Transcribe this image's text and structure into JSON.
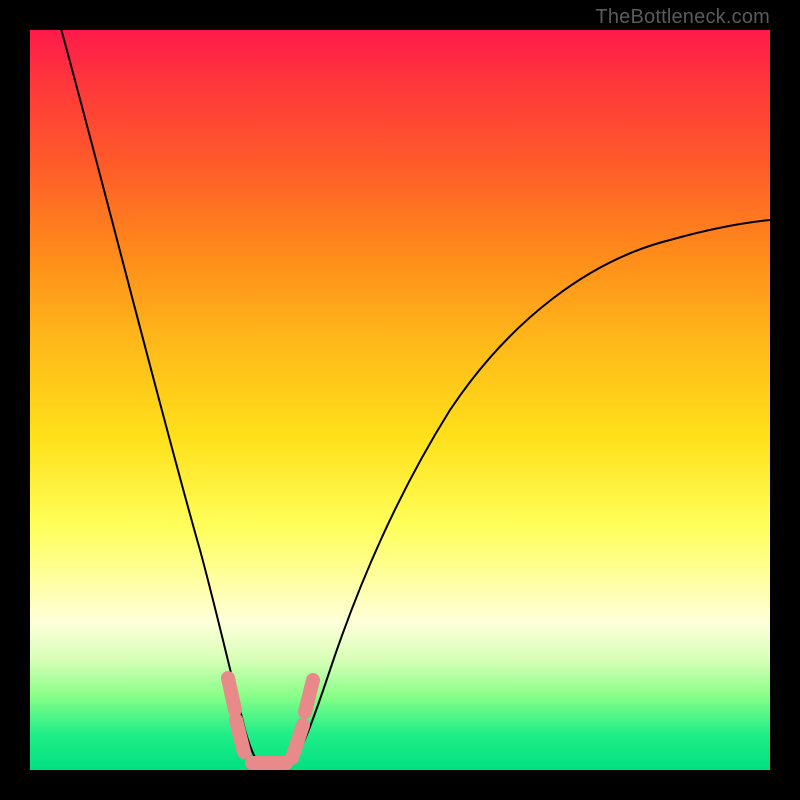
{
  "watermark": "TheBottleneck.com",
  "chart_data": {
    "type": "line",
    "title": "",
    "xlabel": "",
    "ylabel": "",
    "x_range": [
      0,
      100
    ],
    "y_range": [
      0,
      100
    ],
    "note": "V-shaped bottleneck curve on a red-to-green gradient background. The curve value indicates distance from optimal (0 at minimum). Values below are estimated from the plotted curve against the vertical gradient.",
    "series": [
      {
        "name": "bottleneck-curve",
        "x": [
          4,
          10,
          15,
          20,
          23,
          25,
          27,
          29,
          30,
          32,
          34,
          36,
          40,
          45,
          50,
          55,
          60,
          70,
          80,
          90,
          100
        ],
        "values": [
          100,
          80,
          60,
          40,
          25,
          15,
          8,
          3,
          0,
          0,
          3,
          8,
          18,
          30,
          40,
          48,
          54,
          63,
          68,
          71,
          73
        ]
      }
    ],
    "minimum_region": {
      "x_start": 29,
      "x_end": 33,
      "value": 0
    },
    "markers": {
      "description": "Short salmon tick marks near the curve trough",
      "color": "#e88a8a",
      "segments": [
        {
          "x1": 26.5,
          "y1": 12,
          "x2": 27.5,
          "y2": 7
        },
        {
          "x1": 27.5,
          "y1": 6,
          "x2": 28.5,
          "y2": 2
        },
        {
          "x1": 29.5,
          "y1": 1,
          "x2": 33.5,
          "y2": 1
        },
        {
          "x1": 34.5,
          "y1": 2,
          "x2": 36.0,
          "y2": 7
        },
        {
          "x1": 36.0,
          "y1": 9,
          "x2": 37.0,
          "y2": 13
        }
      ]
    },
    "background_gradient": {
      "top": "#ff1a4a",
      "bottom": "#00e080"
    }
  }
}
